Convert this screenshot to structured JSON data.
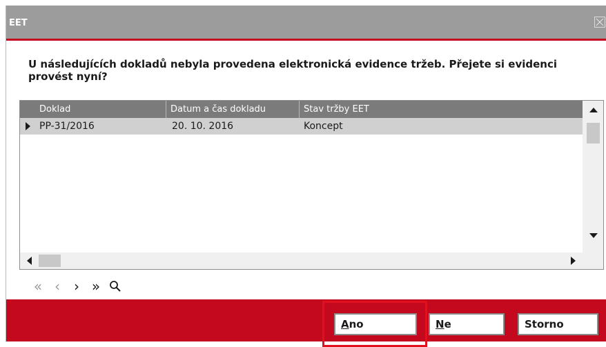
{
  "window": {
    "title": "EET"
  },
  "message": "U následujících dokladů nebyla provedena elektronická evidence tržeb. Přejete si evidenci provést nyní?",
  "table": {
    "columns": [
      "Doklad",
      "Datum a čas dokladu",
      "Stav tržby EET"
    ],
    "rows": [
      {
        "doklad": "PP-31/2016",
        "datum": "20. 10. 2016",
        "stav": "Koncept"
      }
    ]
  },
  "navigation": {
    "first": "«",
    "prev": "‹",
    "next": "›",
    "last": "»",
    "search": "⚲"
  },
  "buttons": {
    "yes": {
      "accel": "A",
      "rest": "no"
    },
    "no": {
      "accel": "N",
      "rest": "e"
    },
    "cancel": "Storno"
  },
  "colors": {
    "accent": "#c4081d",
    "titlebar": "#9c9c9c",
    "header": "#7b7b7b",
    "focus_highlight": "#e0101f"
  }
}
